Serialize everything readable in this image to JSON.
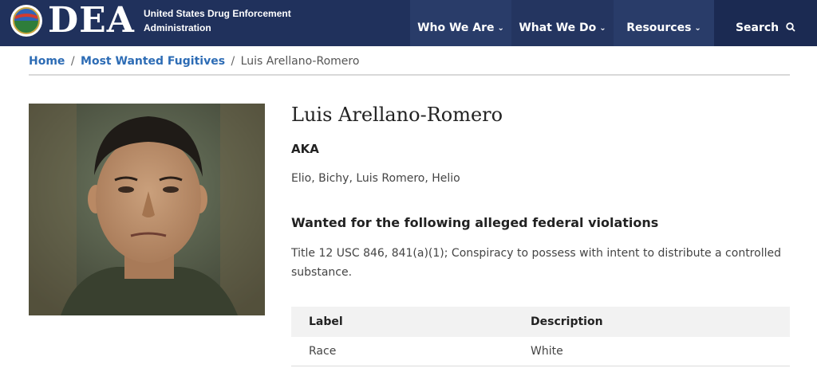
{
  "header": {
    "logo_text": "DEA",
    "agency_line1": "United States Drug Enforcement",
    "agency_line2": "Administration",
    "nav": {
      "who_we_are": "Who We Are",
      "what_we_do": "What We Do",
      "resources": "Resources",
      "search": "Search"
    }
  },
  "breadcrumb": {
    "home": "Home",
    "most_wanted": "Most Wanted Fugitives",
    "current": "Luis Arellano-Romero",
    "separator": "/"
  },
  "fugitive": {
    "name": "Luis Arellano-Romero",
    "aka_heading": "AKA",
    "aka_values": "Elio, Bichy, Luis Romero, Helio",
    "violations_heading": "Wanted for the following alleged federal violations",
    "violations_text": "Title 12 USC 846, 841(a)(1); Conspiracy to possess with intent to distribute a controlled substance."
  },
  "table": {
    "headers": [
      "Label",
      "Description"
    ],
    "rows": [
      {
        "label": "Race",
        "description": "White"
      }
    ]
  },
  "colors": {
    "header_bg": "#20315c",
    "link": "#2d6cb5"
  }
}
